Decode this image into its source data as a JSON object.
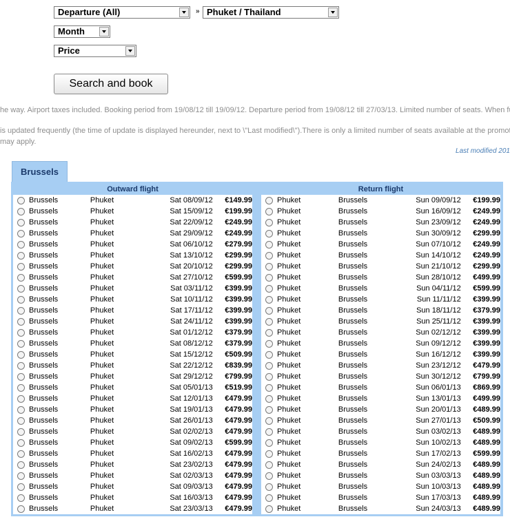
{
  "filters": {
    "departure": "Departure (All)",
    "destination": "Phuket / Thailand",
    "month": "Month",
    "price": "Price",
    "separator": "»"
  },
  "search_button": "Search and book",
  "info": {
    "line1": "he way. Airport taxes included. Booking period from 19/08/12 till 19/09/12. Departure period from 19/08/12 till 27/03/13. Limited number of seats. When fully",
    "line2": "is updated frequently (the time of update is displayed hereunder, next to \\\"Last modified\\\").There is only a limited number of seats available at the promotio",
    "line3": "may apply.",
    "last_modified": "Last modified 201"
  },
  "tab": "Brussels",
  "outward": {
    "header": "Outward flight",
    "rows": [
      {
        "from": "Brussels",
        "to": "Phuket",
        "date": "Sat 08/09/12",
        "price": "€149.99"
      },
      {
        "from": "Brussels",
        "to": "Phuket",
        "date": "Sat 15/09/12",
        "price": "€199.99"
      },
      {
        "from": "Brussels",
        "to": "Phuket",
        "date": "Sat 22/09/12",
        "price": "€249.99"
      },
      {
        "from": "Brussels",
        "to": "Phuket",
        "date": "Sat 29/09/12",
        "price": "€249.99"
      },
      {
        "from": "Brussels",
        "to": "Phuket",
        "date": "Sat 06/10/12",
        "price": "€279.99"
      },
      {
        "from": "Brussels",
        "to": "Phuket",
        "date": "Sat 13/10/12",
        "price": "€299.99"
      },
      {
        "from": "Brussels",
        "to": "Phuket",
        "date": "Sat 20/10/12",
        "price": "€299.99"
      },
      {
        "from": "Brussels",
        "to": "Phuket",
        "date": "Sat 27/10/12",
        "price": "€599.99"
      },
      {
        "from": "Brussels",
        "to": "Phuket",
        "date": "Sat 03/11/12",
        "price": "€399.99"
      },
      {
        "from": "Brussels",
        "to": "Phuket",
        "date": "Sat 10/11/12",
        "price": "€399.99"
      },
      {
        "from": "Brussels",
        "to": "Phuket",
        "date": "Sat 17/11/12",
        "price": "€399.99"
      },
      {
        "from": "Brussels",
        "to": "Phuket",
        "date": "Sat 24/11/12",
        "price": "€399.99"
      },
      {
        "from": "Brussels",
        "to": "Phuket",
        "date": "Sat 01/12/12",
        "price": "€379.99"
      },
      {
        "from": "Brussels",
        "to": "Phuket",
        "date": "Sat 08/12/12",
        "price": "€379.99"
      },
      {
        "from": "Brussels",
        "to": "Phuket",
        "date": "Sat 15/12/12",
        "price": "€509.99"
      },
      {
        "from": "Brussels",
        "to": "Phuket",
        "date": "Sat 22/12/12",
        "price": "€839.99"
      },
      {
        "from": "Brussels",
        "to": "Phuket",
        "date": "Sat 29/12/12",
        "price": "€799.99"
      },
      {
        "from": "Brussels",
        "to": "Phuket",
        "date": "Sat 05/01/13",
        "price": "€519.99"
      },
      {
        "from": "Brussels",
        "to": "Phuket",
        "date": "Sat 12/01/13",
        "price": "€479.99"
      },
      {
        "from": "Brussels",
        "to": "Phuket",
        "date": "Sat 19/01/13",
        "price": "€479.99"
      },
      {
        "from": "Brussels",
        "to": "Phuket",
        "date": "Sat 26/01/13",
        "price": "€479.99"
      },
      {
        "from": "Brussels",
        "to": "Phuket",
        "date": "Sat 02/02/13",
        "price": "€479.99"
      },
      {
        "from": "Brussels",
        "to": "Phuket",
        "date": "Sat 09/02/13",
        "price": "€599.99"
      },
      {
        "from": "Brussels",
        "to": "Phuket",
        "date": "Sat 16/02/13",
        "price": "€479.99"
      },
      {
        "from": "Brussels",
        "to": "Phuket",
        "date": "Sat 23/02/13",
        "price": "€479.99"
      },
      {
        "from": "Brussels",
        "to": "Phuket",
        "date": "Sat 02/03/13",
        "price": "€479.99"
      },
      {
        "from": "Brussels",
        "to": "Phuket",
        "date": "Sat 09/03/13",
        "price": "€479.99"
      },
      {
        "from": "Brussels",
        "to": "Phuket",
        "date": "Sat 16/03/13",
        "price": "€479.99"
      },
      {
        "from": "Brussels",
        "to": "Phuket",
        "date": "Sat 23/03/13",
        "price": "€479.99"
      }
    ]
  },
  "return": {
    "header": "Return flight",
    "rows": [
      {
        "from": "Phuket",
        "to": "Brussels",
        "date": "Sun 09/09/12",
        "price": "€199.99"
      },
      {
        "from": "Phuket",
        "to": "Brussels",
        "date": "Sun 16/09/12",
        "price": "€249.99"
      },
      {
        "from": "Phuket",
        "to": "Brussels",
        "date": "Sun 23/09/12",
        "price": "€249.99"
      },
      {
        "from": "Phuket",
        "to": "Brussels",
        "date": "Sun 30/09/12",
        "price": "€299.99"
      },
      {
        "from": "Phuket",
        "to": "Brussels",
        "date": "Sun 07/10/12",
        "price": "€249.99"
      },
      {
        "from": "Phuket",
        "to": "Brussels",
        "date": "Sun 14/10/12",
        "price": "€249.99"
      },
      {
        "from": "Phuket",
        "to": "Brussels",
        "date": "Sun 21/10/12",
        "price": "€299.99"
      },
      {
        "from": "Phuket",
        "to": "Brussels",
        "date": "Sun 28/10/12",
        "price": "€499.99"
      },
      {
        "from": "Phuket",
        "to": "Brussels",
        "date": "Sun 04/11/12",
        "price": "€599.99"
      },
      {
        "from": "Phuket",
        "to": "Brussels",
        "date": "Sun 11/11/12",
        "price": "€399.99"
      },
      {
        "from": "Phuket",
        "to": "Brussels",
        "date": "Sun 18/11/12",
        "price": "€379.99"
      },
      {
        "from": "Phuket",
        "to": "Brussels",
        "date": "Sun 25/11/12",
        "price": "€399.99"
      },
      {
        "from": "Phuket",
        "to": "Brussels",
        "date": "Sun 02/12/12",
        "price": "€399.99"
      },
      {
        "from": "Phuket",
        "to": "Brussels",
        "date": "Sun 09/12/12",
        "price": "€399.99"
      },
      {
        "from": "Phuket",
        "to": "Brussels",
        "date": "Sun 16/12/12",
        "price": "€399.99"
      },
      {
        "from": "Phuket",
        "to": "Brussels",
        "date": "Sun 23/12/12",
        "price": "€479.99"
      },
      {
        "from": "Phuket",
        "to": "Brussels",
        "date": "Sun 30/12/12",
        "price": "€799.99"
      },
      {
        "from": "Phuket",
        "to": "Brussels",
        "date": "Sun 06/01/13",
        "price": "€869.99"
      },
      {
        "from": "Phuket",
        "to": "Brussels",
        "date": "Sun 13/01/13",
        "price": "€499.99"
      },
      {
        "from": "Phuket",
        "to": "Brussels",
        "date": "Sun 20/01/13",
        "price": "€489.99"
      },
      {
        "from": "Phuket",
        "to": "Brussels",
        "date": "Sun 27/01/13",
        "price": "€509.99"
      },
      {
        "from": "Phuket",
        "to": "Brussels",
        "date": "Sun 03/02/13",
        "price": "€489.99"
      },
      {
        "from": "Phuket",
        "to": "Brussels",
        "date": "Sun 10/02/13",
        "price": "€489.99"
      },
      {
        "from": "Phuket",
        "to": "Brussels",
        "date": "Sun 17/02/13",
        "price": "€599.99"
      },
      {
        "from": "Phuket",
        "to": "Brussels",
        "date": "Sun 24/02/13",
        "price": "€489.99"
      },
      {
        "from": "Phuket",
        "to": "Brussels",
        "date": "Sun 03/03/13",
        "price": "€489.99"
      },
      {
        "from": "Phuket",
        "to": "Brussels",
        "date": "Sun 10/03/13",
        "price": "€489.99"
      },
      {
        "from": "Phuket",
        "to": "Brussels",
        "date": "Sun 17/03/13",
        "price": "€489.99"
      },
      {
        "from": "Phuket",
        "to": "Brussels",
        "date": "Sun 24/03/13",
        "price": "€489.99"
      }
    ]
  }
}
